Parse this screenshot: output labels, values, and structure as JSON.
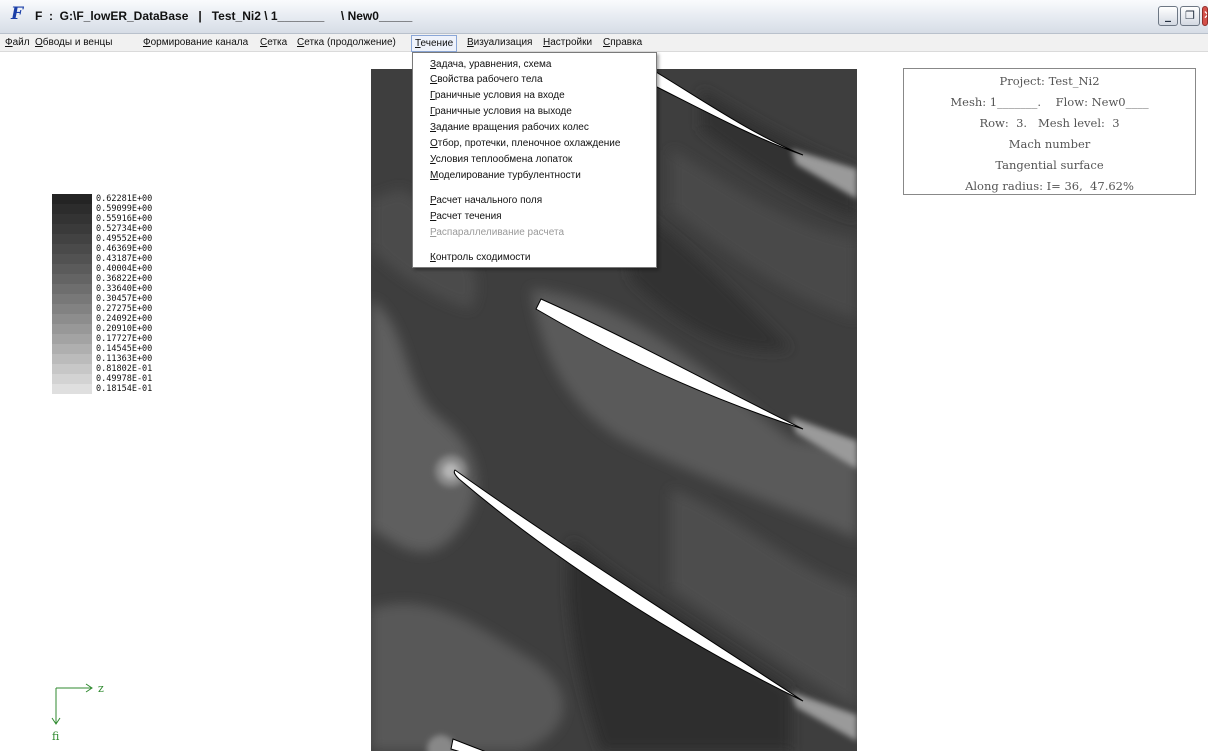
{
  "window": {
    "title": "F  :  G:\\F_lowER_DataBase   |   Test_Ni2 \\ 1_______     \\ New0_____",
    "icon_letter": "F",
    "buttons": {
      "minimize": "_",
      "restore": "❐",
      "close": "✕"
    }
  },
  "menubar": {
    "items": [
      {
        "first": "Ф",
        "rest": "айл"
      },
      {
        "first": "О",
        "rest": "бводы и венцы"
      },
      {
        "first": "Ф",
        "rest": "ормирование канала"
      },
      {
        "first": "С",
        "rest": "етка"
      },
      {
        "first": "С",
        "rest": "етка (продолжение)"
      },
      {
        "first": "Т",
        "rest": "ечение"
      },
      {
        "first": "В",
        "rest": "изуализация"
      },
      {
        "first": "Н",
        "rest": "астройки"
      },
      {
        "first": "С",
        "rest": "правка"
      }
    ],
    "active_index": 5
  },
  "dropdown": {
    "items": [
      {
        "first": "З",
        "rest": "адача, уравнения, схема",
        "enabled": true
      },
      {
        "first": "С",
        "rest": "войства рабочего тела",
        "enabled": true
      },
      {
        "first": "Г",
        "rest": "раничные условия на входе",
        "enabled": true
      },
      {
        "first": "Г",
        "rest": "раничные условия на выходе",
        "enabled": true
      },
      {
        "first": "З",
        "rest": "адание вращения рабочих колес",
        "enabled": true
      },
      {
        "first": "О",
        "rest": "тбор, протечки, пленочное охлаждение",
        "enabled": true
      },
      {
        "first": "У",
        "rest": "словия теплообмена лопаток",
        "enabled": true
      },
      {
        "first": "М",
        "rest": "оделирование турбулентности",
        "enabled": true
      },
      {
        "first": "Р",
        "rest": "асчет начального поля",
        "enabled": true
      },
      {
        "first": "Р",
        "rest": "асчет течения",
        "enabled": true
      },
      {
        "first": "Р",
        "rest": "аспараллеливание расчета",
        "enabled": false
      },
      {
        "first": "К",
        "rest": "онтроль сходимости",
        "enabled": true
      }
    ]
  },
  "legend": {
    "labels": [
      "0.62281E+00",
      "0.59099E+00",
      "0.55916E+00",
      "0.52734E+00",
      "0.49552E+00",
      "0.46369E+00",
      "0.43187E+00",
      "0.40004E+00",
      "0.36822E+00",
      "0.33640E+00",
      "0.30457E+00",
      "0.27275E+00",
      "0.24092E+00",
      "0.20910E+00",
      "0.17727E+00",
      "0.14545E+00",
      "0.11363E+00",
      "0.81802E-01",
      "0.49978E-01",
      "0.18154E-01"
    ],
    "colors": [
      "#242424",
      "#2c2c2c",
      "#333333",
      "#3a3a3a",
      "#424242",
      "#4a4a4a",
      "#525252",
      "#5b5b5b",
      "#646464",
      "#6e6e6e",
      "#787878",
      "#828282",
      "#8d8d8d",
      "#989898",
      "#a3a3a3",
      "#afafaf",
      "#bbbbbb",
      "#c7c7c7",
      "#d3d3d3",
      "#dfdfdf"
    ]
  },
  "info": {
    "project": "Project: Test_Ni2",
    "mesh_flow": "Mesh: 1_______.    Flow: New0____",
    "row_level": "Row:  3.   Mesh level:  3",
    "quantity": "Mach number",
    "surface": "Tangential surface",
    "position": "Along radius: I= 36,  47.62%"
  },
  "axes": {
    "x_label": "z",
    "y_label": "fi"
  },
  "plot": {
    "background": "#3e3e3e",
    "blade_color": "#ffffff",
    "blade_outline": "#000000"
  }
}
